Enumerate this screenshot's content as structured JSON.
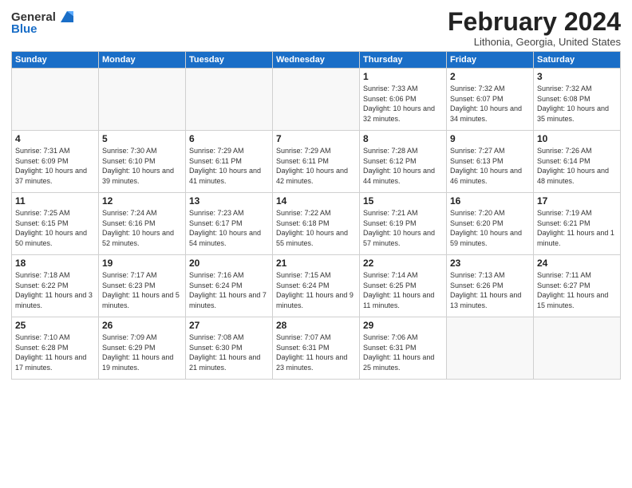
{
  "logo": {
    "general": "General",
    "blue": "Blue"
  },
  "header": {
    "month_year": "February 2024",
    "location": "Lithonia, Georgia, United States"
  },
  "weekdays": [
    "Sunday",
    "Monday",
    "Tuesday",
    "Wednesday",
    "Thursday",
    "Friday",
    "Saturday"
  ],
  "weeks": [
    [
      {
        "day": "",
        "sunrise": "",
        "sunset": "",
        "daylight": ""
      },
      {
        "day": "",
        "sunrise": "",
        "sunset": "",
        "daylight": ""
      },
      {
        "day": "",
        "sunrise": "",
        "sunset": "",
        "daylight": ""
      },
      {
        "day": "",
        "sunrise": "",
        "sunset": "",
        "daylight": ""
      },
      {
        "day": "1",
        "sunrise": "Sunrise: 7:33 AM",
        "sunset": "Sunset: 6:06 PM",
        "daylight": "Daylight: 10 hours and 32 minutes."
      },
      {
        "day": "2",
        "sunrise": "Sunrise: 7:32 AM",
        "sunset": "Sunset: 6:07 PM",
        "daylight": "Daylight: 10 hours and 34 minutes."
      },
      {
        "day": "3",
        "sunrise": "Sunrise: 7:32 AM",
        "sunset": "Sunset: 6:08 PM",
        "daylight": "Daylight: 10 hours and 35 minutes."
      }
    ],
    [
      {
        "day": "4",
        "sunrise": "Sunrise: 7:31 AM",
        "sunset": "Sunset: 6:09 PM",
        "daylight": "Daylight: 10 hours and 37 minutes."
      },
      {
        "day": "5",
        "sunrise": "Sunrise: 7:30 AM",
        "sunset": "Sunset: 6:10 PM",
        "daylight": "Daylight: 10 hours and 39 minutes."
      },
      {
        "day": "6",
        "sunrise": "Sunrise: 7:29 AM",
        "sunset": "Sunset: 6:11 PM",
        "daylight": "Daylight: 10 hours and 41 minutes."
      },
      {
        "day": "7",
        "sunrise": "Sunrise: 7:29 AM",
        "sunset": "Sunset: 6:11 PM",
        "daylight": "Daylight: 10 hours and 42 minutes."
      },
      {
        "day": "8",
        "sunrise": "Sunrise: 7:28 AM",
        "sunset": "Sunset: 6:12 PM",
        "daylight": "Daylight: 10 hours and 44 minutes."
      },
      {
        "day": "9",
        "sunrise": "Sunrise: 7:27 AM",
        "sunset": "Sunset: 6:13 PM",
        "daylight": "Daylight: 10 hours and 46 minutes."
      },
      {
        "day": "10",
        "sunrise": "Sunrise: 7:26 AM",
        "sunset": "Sunset: 6:14 PM",
        "daylight": "Daylight: 10 hours and 48 minutes."
      }
    ],
    [
      {
        "day": "11",
        "sunrise": "Sunrise: 7:25 AM",
        "sunset": "Sunset: 6:15 PM",
        "daylight": "Daylight: 10 hours and 50 minutes."
      },
      {
        "day": "12",
        "sunrise": "Sunrise: 7:24 AM",
        "sunset": "Sunset: 6:16 PM",
        "daylight": "Daylight: 10 hours and 52 minutes."
      },
      {
        "day": "13",
        "sunrise": "Sunrise: 7:23 AM",
        "sunset": "Sunset: 6:17 PM",
        "daylight": "Daylight: 10 hours and 54 minutes."
      },
      {
        "day": "14",
        "sunrise": "Sunrise: 7:22 AM",
        "sunset": "Sunset: 6:18 PM",
        "daylight": "Daylight: 10 hours and 55 minutes."
      },
      {
        "day": "15",
        "sunrise": "Sunrise: 7:21 AM",
        "sunset": "Sunset: 6:19 PM",
        "daylight": "Daylight: 10 hours and 57 minutes."
      },
      {
        "day": "16",
        "sunrise": "Sunrise: 7:20 AM",
        "sunset": "Sunset: 6:20 PM",
        "daylight": "Daylight: 10 hours and 59 minutes."
      },
      {
        "day": "17",
        "sunrise": "Sunrise: 7:19 AM",
        "sunset": "Sunset: 6:21 PM",
        "daylight": "Daylight: 11 hours and 1 minute."
      }
    ],
    [
      {
        "day": "18",
        "sunrise": "Sunrise: 7:18 AM",
        "sunset": "Sunset: 6:22 PM",
        "daylight": "Daylight: 11 hours and 3 minutes."
      },
      {
        "day": "19",
        "sunrise": "Sunrise: 7:17 AM",
        "sunset": "Sunset: 6:23 PM",
        "daylight": "Daylight: 11 hours and 5 minutes."
      },
      {
        "day": "20",
        "sunrise": "Sunrise: 7:16 AM",
        "sunset": "Sunset: 6:24 PM",
        "daylight": "Daylight: 11 hours and 7 minutes."
      },
      {
        "day": "21",
        "sunrise": "Sunrise: 7:15 AM",
        "sunset": "Sunset: 6:24 PM",
        "daylight": "Daylight: 11 hours and 9 minutes."
      },
      {
        "day": "22",
        "sunrise": "Sunrise: 7:14 AM",
        "sunset": "Sunset: 6:25 PM",
        "daylight": "Daylight: 11 hours and 11 minutes."
      },
      {
        "day": "23",
        "sunrise": "Sunrise: 7:13 AM",
        "sunset": "Sunset: 6:26 PM",
        "daylight": "Daylight: 11 hours and 13 minutes."
      },
      {
        "day": "24",
        "sunrise": "Sunrise: 7:11 AM",
        "sunset": "Sunset: 6:27 PM",
        "daylight": "Daylight: 11 hours and 15 minutes."
      }
    ],
    [
      {
        "day": "25",
        "sunrise": "Sunrise: 7:10 AM",
        "sunset": "Sunset: 6:28 PM",
        "daylight": "Daylight: 11 hours and 17 minutes."
      },
      {
        "day": "26",
        "sunrise": "Sunrise: 7:09 AM",
        "sunset": "Sunset: 6:29 PM",
        "daylight": "Daylight: 11 hours and 19 minutes."
      },
      {
        "day": "27",
        "sunrise": "Sunrise: 7:08 AM",
        "sunset": "Sunset: 6:30 PM",
        "daylight": "Daylight: 11 hours and 21 minutes."
      },
      {
        "day": "28",
        "sunrise": "Sunrise: 7:07 AM",
        "sunset": "Sunset: 6:31 PM",
        "daylight": "Daylight: 11 hours and 23 minutes."
      },
      {
        "day": "29",
        "sunrise": "Sunrise: 7:06 AM",
        "sunset": "Sunset: 6:31 PM",
        "daylight": "Daylight: 11 hours and 25 minutes."
      },
      {
        "day": "",
        "sunrise": "",
        "sunset": "",
        "daylight": ""
      },
      {
        "day": "",
        "sunrise": "",
        "sunset": "",
        "daylight": ""
      }
    ]
  ]
}
